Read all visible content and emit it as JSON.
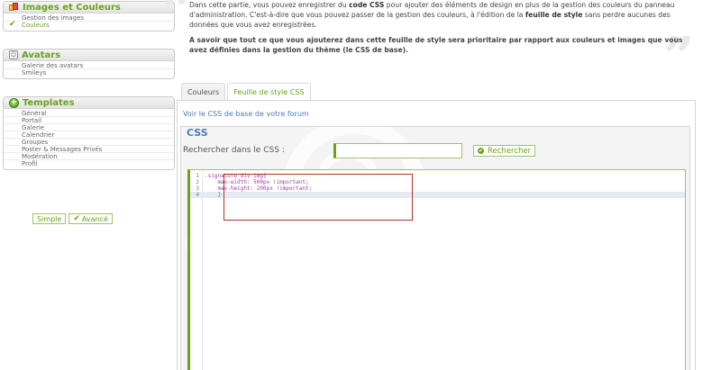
{
  "sidebar": {
    "images_section": {
      "title": "Images et Couleurs",
      "items": [
        "Gestion des images",
        "Couleurs"
      ]
    },
    "avatars_section": {
      "title": "Avatars",
      "items": [
        "Galerie des avatars",
        "Smileys"
      ]
    },
    "templates_section": {
      "title": "Templates",
      "items": [
        "Général",
        "Portail",
        "Galerie",
        "Calendrier",
        "Groupes",
        "Poster & Messages Privés",
        "Modération",
        "Profil"
      ]
    },
    "mode_simple": "Simple",
    "mode_advanced": "Avancé"
  },
  "intro": {
    "p1_a": "Dans cette partie, vous pouvez enregistrer du ",
    "p1_b": "code CSS",
    "p1_c": " pour ajouter des éléments de design en plus de la gestion des couleurs du panneau d'administration. C'est-à-dire que vous pouvez passer de la gestion des couleurs, à l'édition de la ",
    "p1_d": "feuille de style",
    "p1_e": " sans perdre aucunes des données que vous avez enregistrées.",
    "p2": "A savoir que tout ce que vous ajouterez dans cette feuille de style sera prioritaire par rapport aux couleurs et images que vous avez définies dans la gestion du thème (le CSS de base)."
  },
  "tabs": [
    "Couleurs",
    "Feuille de style CSS"
  ],
  "panel": {
    "link": "Voir le CSS de base de votre forum",
    "legend": "CSS",
    "search_label": "Rechercher dans le CSS :",
    "search_value": "",
    "search_button": "Rechercher"
  },
  "editor": {
    "lines": [
      {
        "num": "1",
        "text": ".signature_div img{"
      },
      {
        "num": "2",
        "text": "    max-width: 500px !important;"
      },
      {
        "num": "3",
        "text": "    max-height: 200px !important;"
      },
      {
        "num": "4",
        "text": "    }"
      }
    ]
  },
  "colors": {
    "accent_green": "#6aa11e",
    "link_blue": "#4b7cb7",
    "highlight_red": "#b8312b"
  }
}
